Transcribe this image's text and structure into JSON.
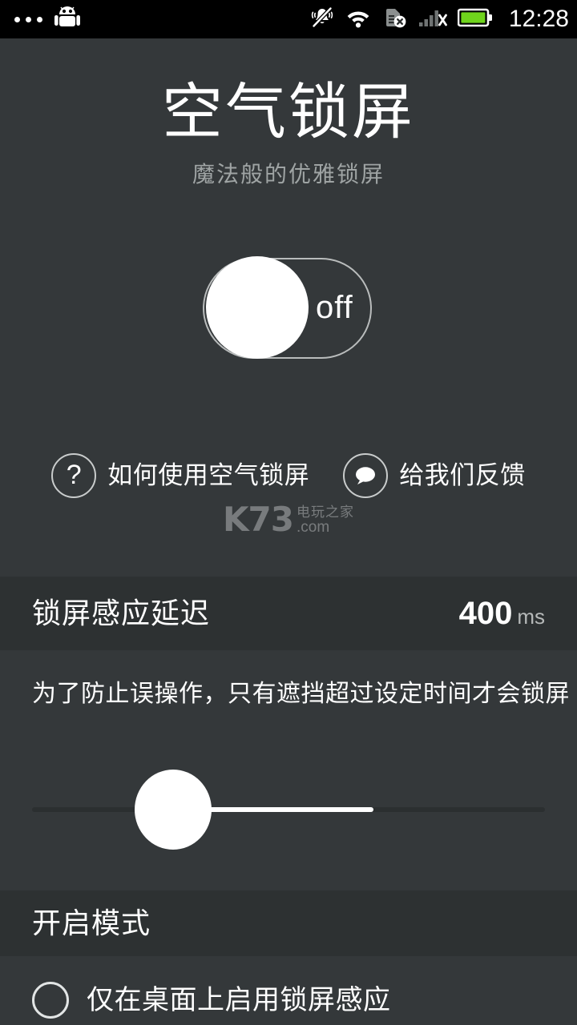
{
  "statusbar": {
    "time": "12:28",
    "left_icons": [
      "overflow-dots",
      "android-robot"
    ],
    "right_icons": [
      "vibrate-mute",
      "wifi",
      "sim-card-missing",
      "signal-no-service",
      "battery-full"
    ],
    "battery_color": "#6fd41c"
  },
  "hero": {
    "title": "空气锁屏",
    "subtitle": "魔法般的优雅锁屏",
    "toggle": {
      "state_label": "off",
      "state": "off"
    },
    "links": [
      {
        "icon": "question-mark-icon",
        "label": "如何使用空气锁屏"
      },
      {
        "icon": "speech-bubble-icon",
        "label": "给我们反馈"
      }
    ],
    "watermark": {
      "brand": "K73",
      "cn": "电玩之家",
      "domain": ".com"
    }
  },
  "delay_section": {
    "title": "锁屏感应延迟",
    "value": "400",
    "unit": "ms",
    "description": "为了防止误操作，只有遮挡超过设定时间才会锁屏"
  },
  "mode_section": {
    "title": "开启模式",
    "options": [
      {
        "label": "仅在桌面上启用锁屏感应",
        "selected": false
      }
    ]
  },
  "colors": {
    "background": "#34383a",
    "section_header_background": "#2d3132",
    "statusbar_background": "#000000",
    "accent_white": "#ffffff",
    "muted_text": "#9fa4a4"
  }
}
